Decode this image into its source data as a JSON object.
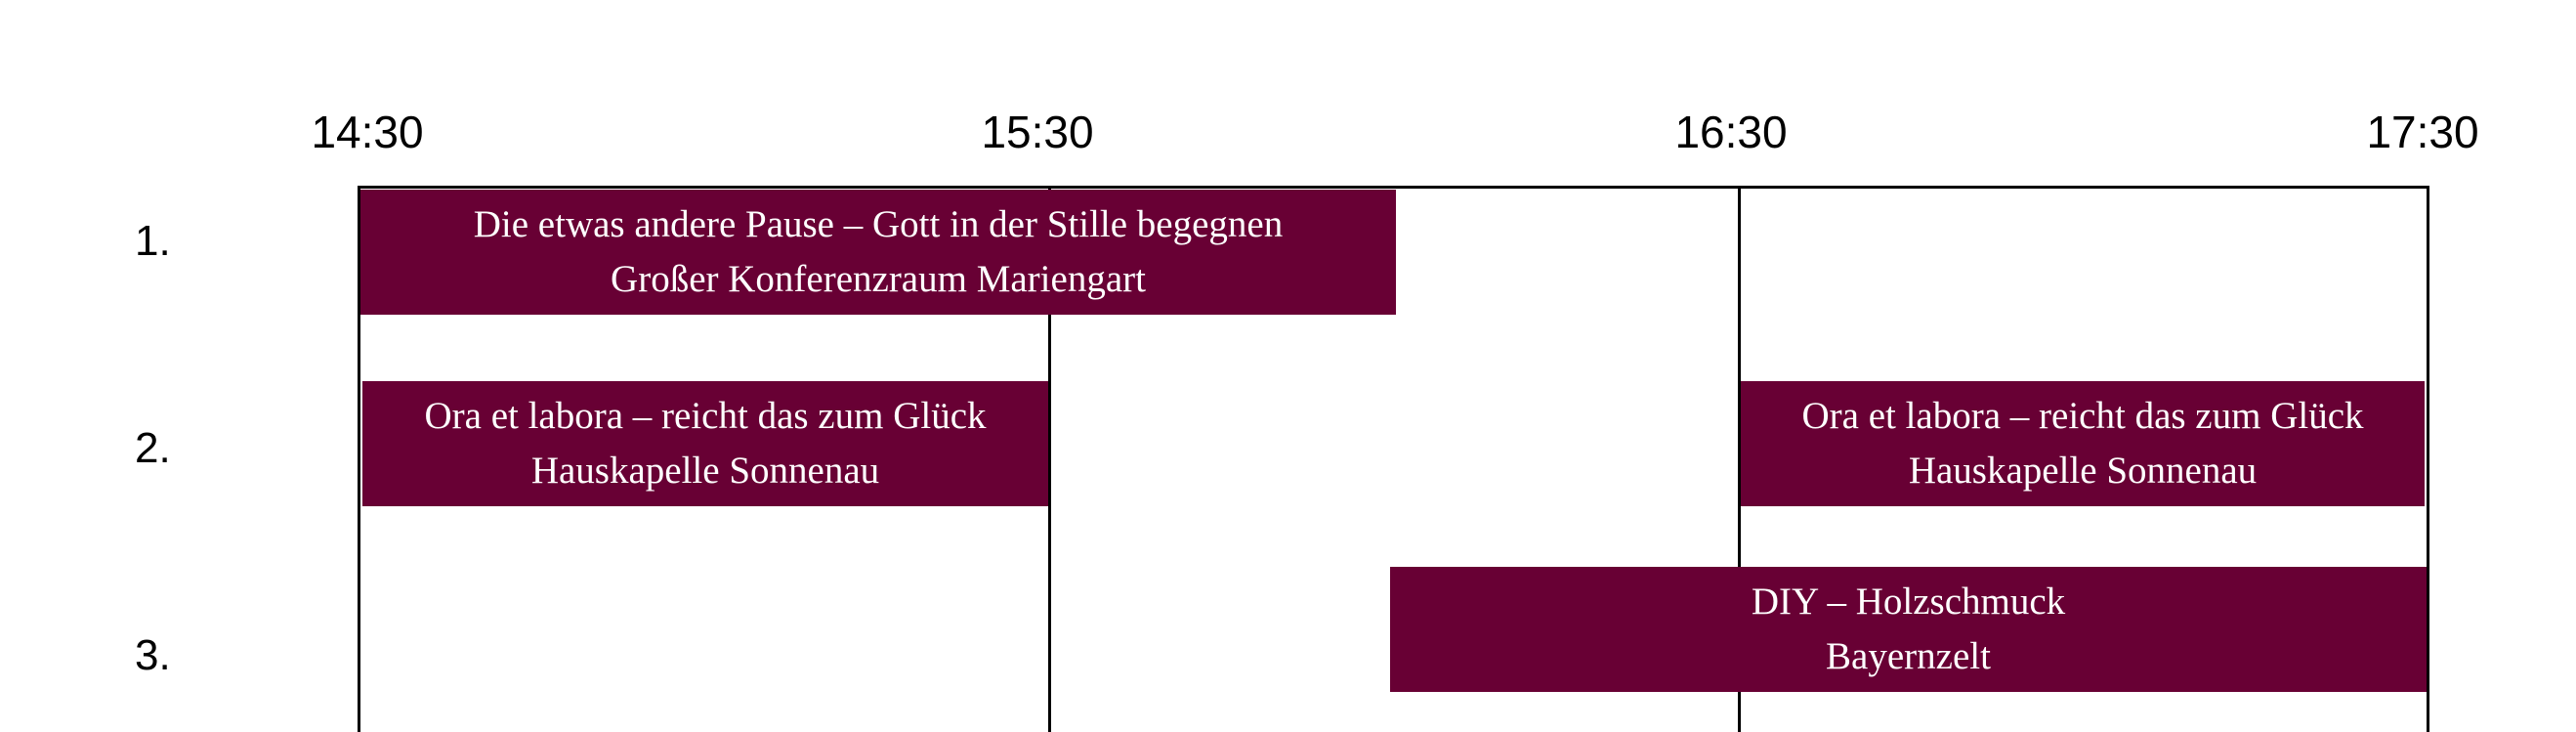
{
  "timeline": {
    "times": [
      "14:30",
      "15:30",
      "16:30",
      "17:30"
    ]
  },
  "rows": [
    {
      "label": "1."
    },
    {
      "label": "2."
    },
    {
      "label": "3."
    }
  ],
  "events": [
    {
      "title": "Die etwas andere Pause – Gott in der Stille begegnen",
      "location": "Großer Konferenzraum Mariengart"
    },
    {
      "title": "Ora et labora – reicht das zum Glück",
      "location": "Hauskapelle Sonnenau"
    },
    {
      "title": "Ora et labora – reicht das zum Glück",
      "location": "Hauskapelle Sonnenau"
    },
    {
      "title": "DIY – Holzschmuck",
      "location": "Bayernzelt"
    }
  ],
  "colors": {
    "event_fill": "#680034",
    "event_text": "#ffffff",
    "grid_line": "#000000"
  }
}
